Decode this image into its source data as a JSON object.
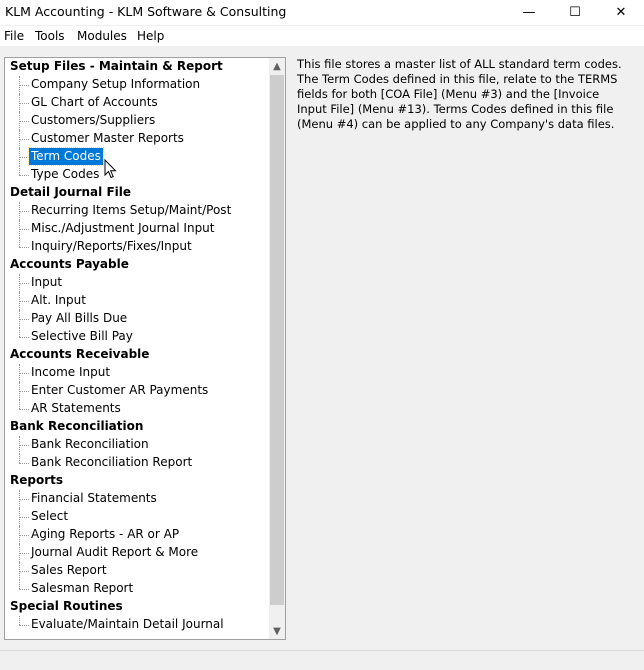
{
  "window": {
    "title": "KLM Accounting - KLM Software & Consulting",
    "minimize_glyph": "—",
    "maximize_glyph": "☐",
    "close_glyph": "✕"
  },
  "menubar": {
    "file": "File",
    "tools": "Tools",
    "modules": "Modules",
    "help": "Help"
  },
  "tree": {
    "selected": "Term Codes",
    "nodes": [
      {
        "type": "cat",
        "label": "Setup Files - Maintain & Report"
      },
      {
        "type": "child",
        "label": "Company Setup Information"
      },
      {
        "type": "child",
        "label": "GL Chart of Accounts"
      },
      {
        "type": "child",
        "label": "Customers/Suppliers"
      },
      {
        "type": "child",
        "label": "Customer Master Reports"
      },
      {
        "type": "child",
        "label": "Term Codes"
      },
      {
        "type": "child",
        "label": "Type Codes"
      },
      {
        "type": "cat",
        "label": "Detail Journal File"
      },
      {
        "type": "child",
        "label": "Recurring Items Setup/Maint/Post"
      },
      {
        "type": "child",
        "label": "Misc./Adjustment Journal Input"
      },
      {
        "type": "child",
        "label": "Inquiry/Reports/Fixes/Input"
      },
      {
        "type": "cat",
        "label": "Accounts Payable"
      },
      {
        "type": "child",
        "label": "Input"
      },
      {
        "type": "child",
        "label": "Alt. Input"
      },
      {
        "type": "child",
        "label": "Pay All Bills Due"
      },
      {
        "type": "child",
        "label": "Selective Bill Pay"
      },
      {
        "type": "cat",
        "label": "Accounts Receivable"
      },
      {
        "type": "child",
        "label": "Income Input"
      },
      {
        "type": "child",
        "label": "Enter Customer AR Payments"
      },
      {
        "type": "child",
        "label": "AR Statements"
      },
      {
        "type": "cat",
        "label": "Bank Reconciliation"
      },
      {
        "type": "child",
        "label": "Bank Reconciliation"
      },
      {
        "type": "child",
        "label": "Bank Reconciliation Report"
      },
      {
        "type": "cat",
        "label": "Reports"
      },
      {
        "type": "child",
        "label": "Financial Statements"
      },
      {
        "type": "child",
        "label": "Select"
      },
      {
        "type": "child",
        "label": "Aging Reports - AR or AP"
      },
      {
        "type": "child",
        "label": "Journal Audit Report & More"
      },
      {
        "type": "child",
        "label": "Sales Report"
      },
      {
        "type": "child",
        "label": "Salesman Report"
      },
      {
        "type": "cat",
        "label": "Special Routines"
      },
      {
        "type": "child",
        "label": "Evaluate/Maintain Detail Journal"
      }
    ]
  },
  "scrollbar": {
    "up_glyph": "▲",
    "down_glyph": "▼"
  },
  "description": {
    "text": "This file stores a master list of ALL standard term codes. The Term Codes defined in this file, relate to the TERMS fields for both [COA File] (Menu #3) and the [Invoice Input File] (Menu #13). Terms Codes defined in this file (Menu #4) can be applied to any Company's data files."
  },
  "icons": {
    "cursor": "mouse-pointer-icon"
  }
}
